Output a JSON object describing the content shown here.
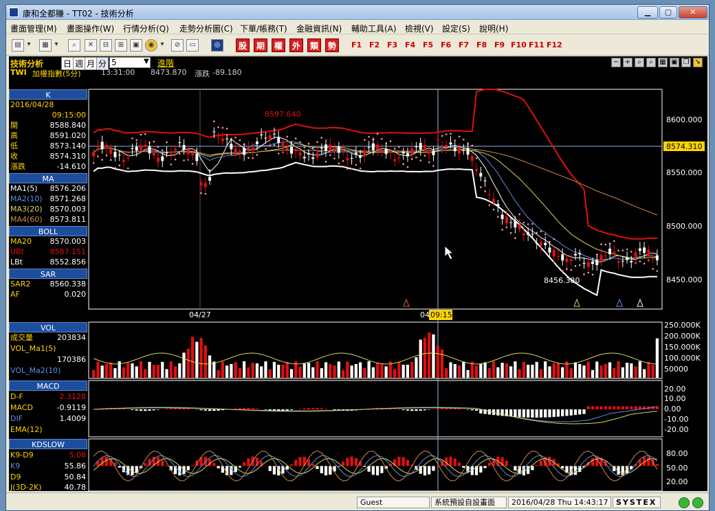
{
  "window": {
    "title": "康和全都賺 - TT02 - 技術分析",
    "minimize": "▁",
    "maximize": "▢",
    "close": "✕"
  },
  "menu": [
    "畫面管理(M)",
    "畫面操作(W)",
    "行情分析(Q)",
    "走勢分析圖(C)",
    "下單/帳務(T)",
    "金融資訊(N)",
    "輔助工具(A)",
    "檢視(V)",
    "設定(S)",
    "說明(H)"
  ],
  "toolbar": {
    "categories": [
      "股",
      "期",
      "權",
      "外",
      "類",
      "勢"
    ],
    "fkeys": [
      "F1",
      "F2",
      "F3",
      "F4",
      "F5",
      "F6",
      "F7",
      "F8",
      "F9",
      "F10",
      "F11",
      "F12"
    ]
  },
  "panel": {
    "title": "技術分析",
    "period_tabs": [
      "日",
      "週",
      "月",
      "分"
    ],
    "interval": "5",
    "advanced": "進階",
    "symbol": "TWI",
    "name": "加權指數(5分)",
    "time": "13:31:00",
    "price": "8473.870",
    "change_label": "漲跌",
    "change": "-89.180"
  },
  "legend": {
    "k": {
      "header": "K",
      "date": "2016/04/28",
      "time": "09:15:00",
      "rows": [
        {
          "k": "開",
          "v": "8588.840"
        },
        {
          "k": "高",
          "v": "8591.020"
        },
        {
          "k": "低",
          "v": "8573.140"
        },
        {
          "k": "收",
          "v": "8574.310"
        },
        {
          "k": "漲跌",
          "v": "-14.610"
        }
      ]
    },
    "ma": {
      "header": "MA",
      "rows": [
        {
          "k": "MA1(5)",
          "v": "8576.206"
        },
        {
          "k": "MA2(10)",
          "v": "8571.268"
        },
        {
          "k": "MA3(20)",
          "v": "8570.003"
        },
        {
          "k": "MA4(60)",
          "v": "8573.811"
        }
      ]
    },
    "boll": {
      "header": "BOLL",
      "rows": [
        {
          "k": "MA20",
          "v": "8570.003"
        },
        {
          "k": "UBt",
          "v": "8587.151"
        },
        {
          "k": "LBt",
          "v": "8552.856"
        }
      ]
    },
    "sar": {
      "header": "SAR",
      "rows": [
        {
          "k": "SAR2",
          "v": "8560.338"
        },
        {
          "k": "AF",
          "v": "0.020"
        }
      ]
    },
    "vol": {
      "header": "VOL",
      "rows": [
        {
          "k": "成交量",
          "v": "203834"
        },
        {
          "k": "VOL_Ma1(5)",
          "v": ""
        },
        {
          "k": "",
          "v": "170386"
        },
        {
          "k": "VOL_Ma2(10)",
          "v": ""
        }
      ]
    },
    "macd": {
      "header": "MACD",
      "rows": [
        {
          "k": "D-F",
          "v": "2.3128"
        },
        {
          "k": "MACD",
          "v": "-0.9119"
        },
        {
          "k": "DIF",
          "v": "1.4009"
        },
        {
          "k": "EMA(12)",
          "v": ""
        }
      ]
    },
    "kd": {
      "header": "KDSLOW",
      "rows": [
        {
          "k": "K9-D9",
          "v": "5.08"
        },
        {
          "k": "K9",
          "v": "55.86"
        },
        {
          "k": "D9",
          "v": "50.84"
        },
        {
          "k": "J(3D-2K)",
          "v": "40.78"
        }
      ]
    }
  },
  "price_axis": {
    "ticks": [
      "8600.000",
      "8550.000",
      "8500.000",
      "8450.000"
    ],
    "current": "8574.310"
  },
  "vol_axis": {
    "ticks": [
      "250.000K",
      "200.000K",
      "150.000K",
      "100.000K",
      "50000"
    ]
  },
  "macd_axis": {
    "ticks": [
      "20.00",
      "10.00",
      "0.00",
      "-10.00",
      "-20.00"
    ]
  },
  "kd_axis": {
    "ticks": [
      "80.00",
      "50.00",
      "20.00"
    ]
  },
  "annotations": {
    "high": "8597.640",
    "low": "8456.380",
    "date_left": "04/27",
    "date_mid": "04",
    "cursor_time": "09:15"
  },
  "status": {
    "user": "Guest",
    "screen": "系統預設自設畫面",
    "datetime": "2016/04/28 Thu 14:43:17",
    "brand": "SYSTEX"
  },
  "colors": {
    "up": "#e01010",
    "down": "#ffffff",
    "boll": "#e01010",
    "ma60": "#d08a4a",
    "ma5": "#ffffff",
    "ma10": "#5c8fe8",
    "ma20": "#d8d860"
  }
}
